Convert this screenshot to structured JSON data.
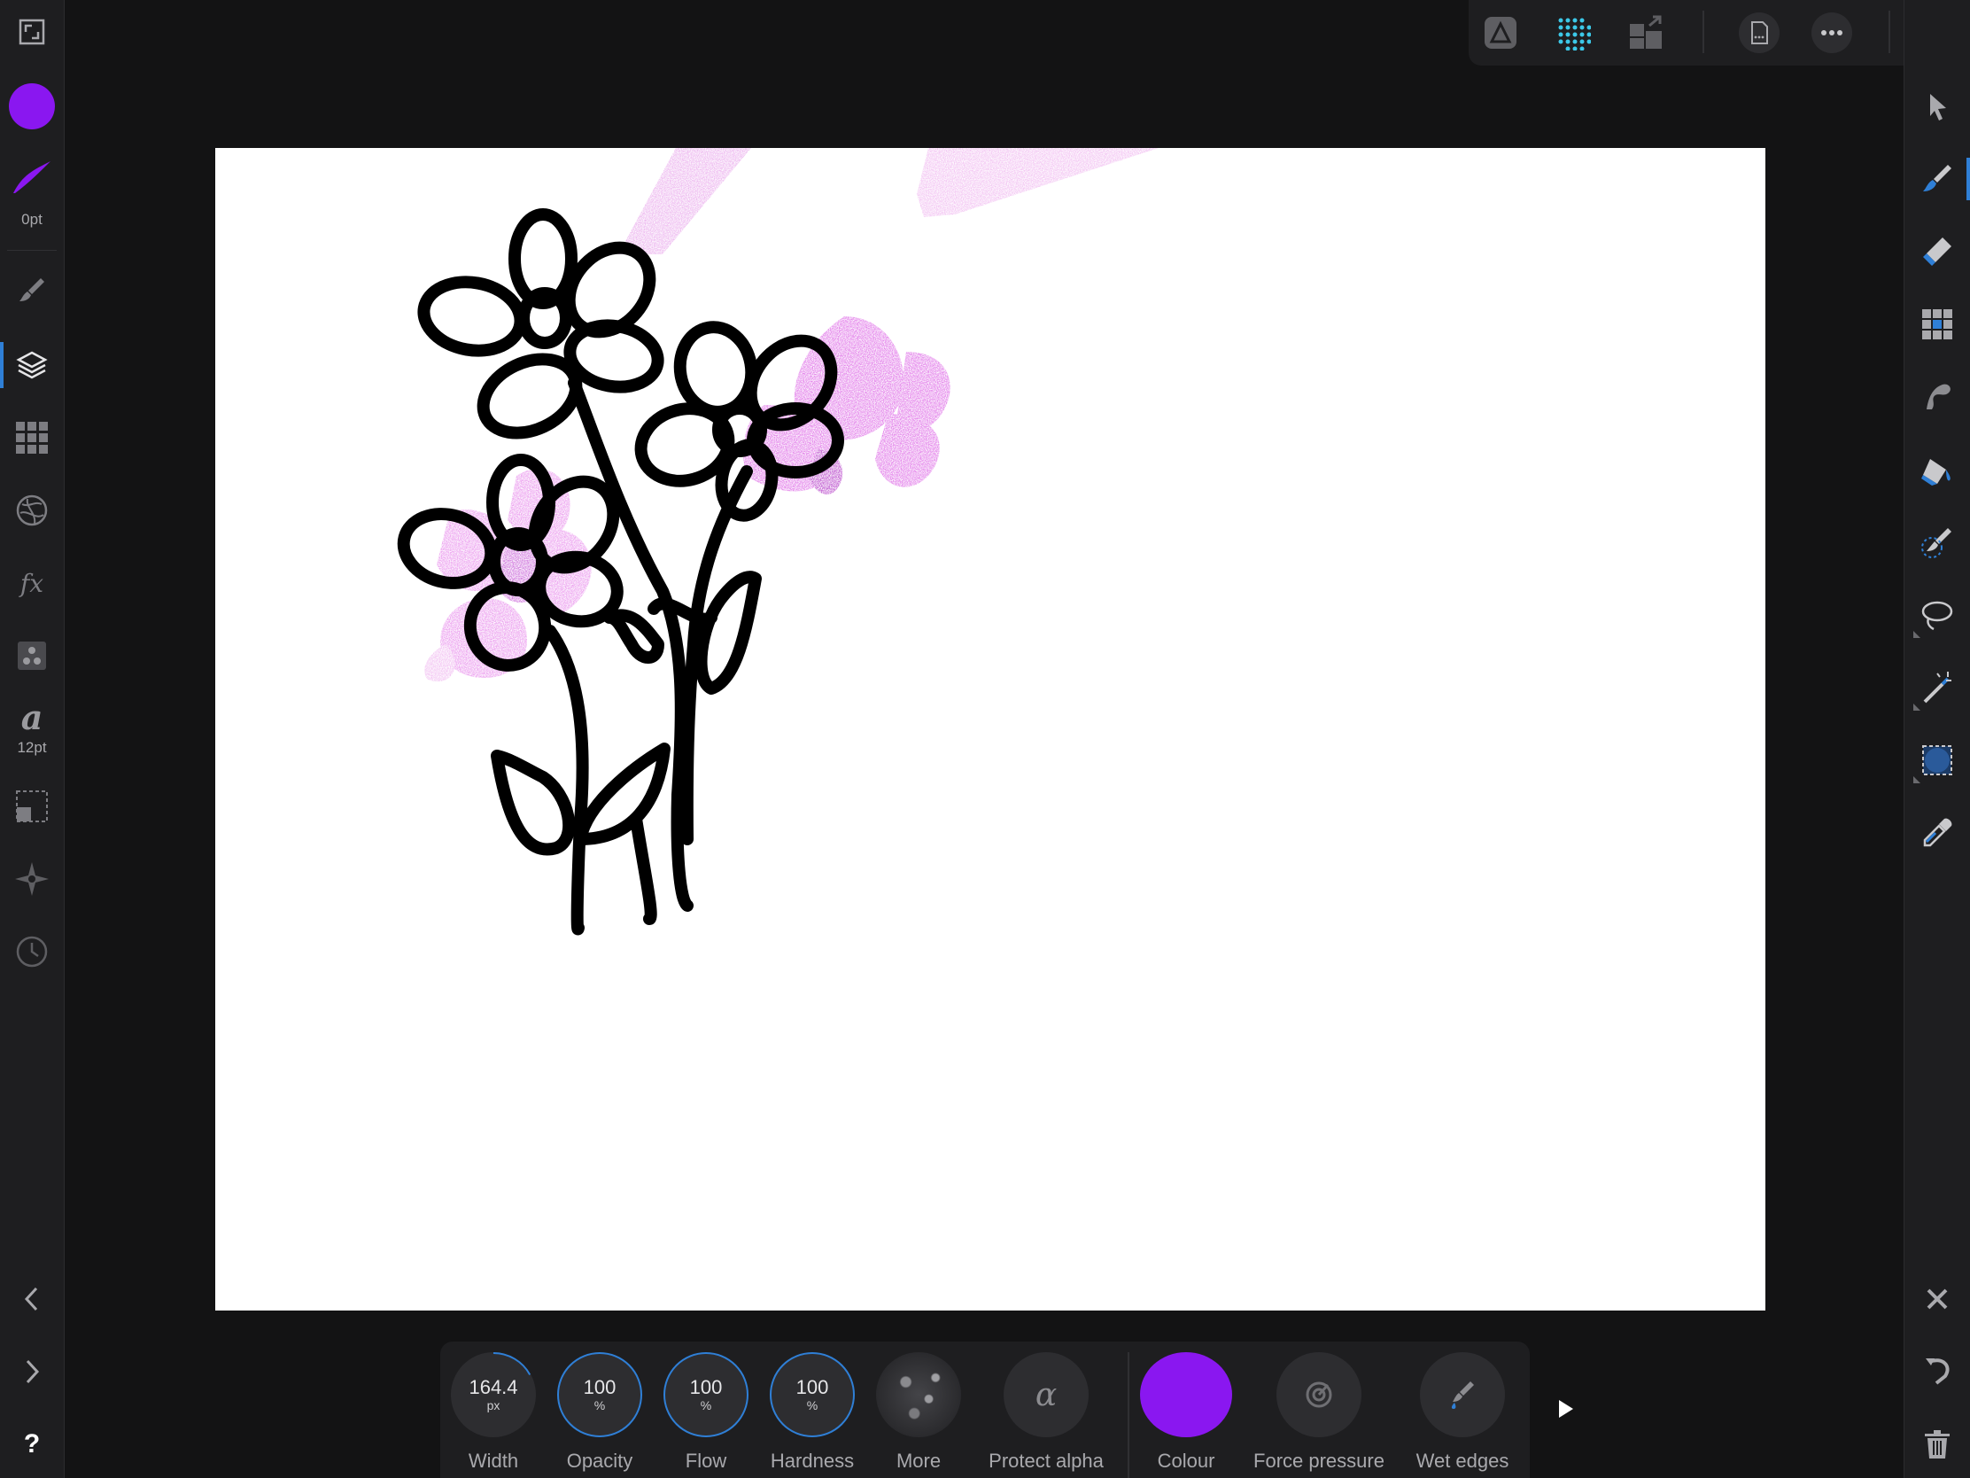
{
  "colors": {
    "accent": "#8a17f0",
    "selection_blue": "#2f7fd6",
    "panel": "#1e1e20",
    "background": "#131314",
    "canvas": "#ffffff",
    "pink_paint": "#e27ae8"
  },
  "left_sidebar": {
    "stroke_width_label": "0pt",
    "text_size_label": "12pt",
    "icons": [
      "fullscreen-icon",
      "color-swatch",
      "brush-stroke-icon",
      "brush-studio-icon",
      "layers-icon",
      "channels-grid-icon",
      "adjustments-icon",
      "fx-icon",
      "styles-icon",
      "text-style-icon",
      "transform-icon",
      "navigator-icon",
      "history-icon",
      "chevron-left-icon",
      "chevron-right-icon",
      "help-icon"
    ],
    "help_label": "?"
  },
  "top_toolbar": {
    "icons": [
      "photo-persona-icon",
      "pixel-persona-icon",
      "export-persona-icon",
      "document-icon",
      "more-icon",
      "back-arrow-icon"
    ]
  },
  "right_toolbar": {
    "tools": [
      "move-tool",
      "paint-brush-tool",
      "erase-brush-tool",
      "pixel-tool",
      "smudge-tool",
      "flood-fill-tool",
      "selection-brush-tool",
      "lasso-tool",
      "magic-wand-tool",
      "marquee-tool",
      "color-picker-tool"
    ],
    "bottom_icons": [
      "close-icon",
      "undo-icon",
      "delete-icon"
    ]
  },
  "context_toolbar": {
    "width": {
      "value": "164.4",
      "unit": "px",
      "label": "Width",
      "fraction": 0.17
    },
    "opacity": {
      "value": "100",
      "unit": "%",
      "label": "Opacity"
    },
    "flow": {
      "value": "100",
      "unit": "%",
      "label": "Flow"
    },
    "hardness": {
      "value": "100",
      "unit": "%",
      "label": "Hardness"
    },
    "more": {
      "label": "More"
    },
    "protect_alpha": {
      "label": "Protect alpha",
      "glyph": "α"
    },
    "colour": {
      "label": "Colour"
    },
    "force_pressure": {
      "label": "Force pressure"
    },
    "wet_edges": {
      "label": "Wet edges"
    }
  }
}
